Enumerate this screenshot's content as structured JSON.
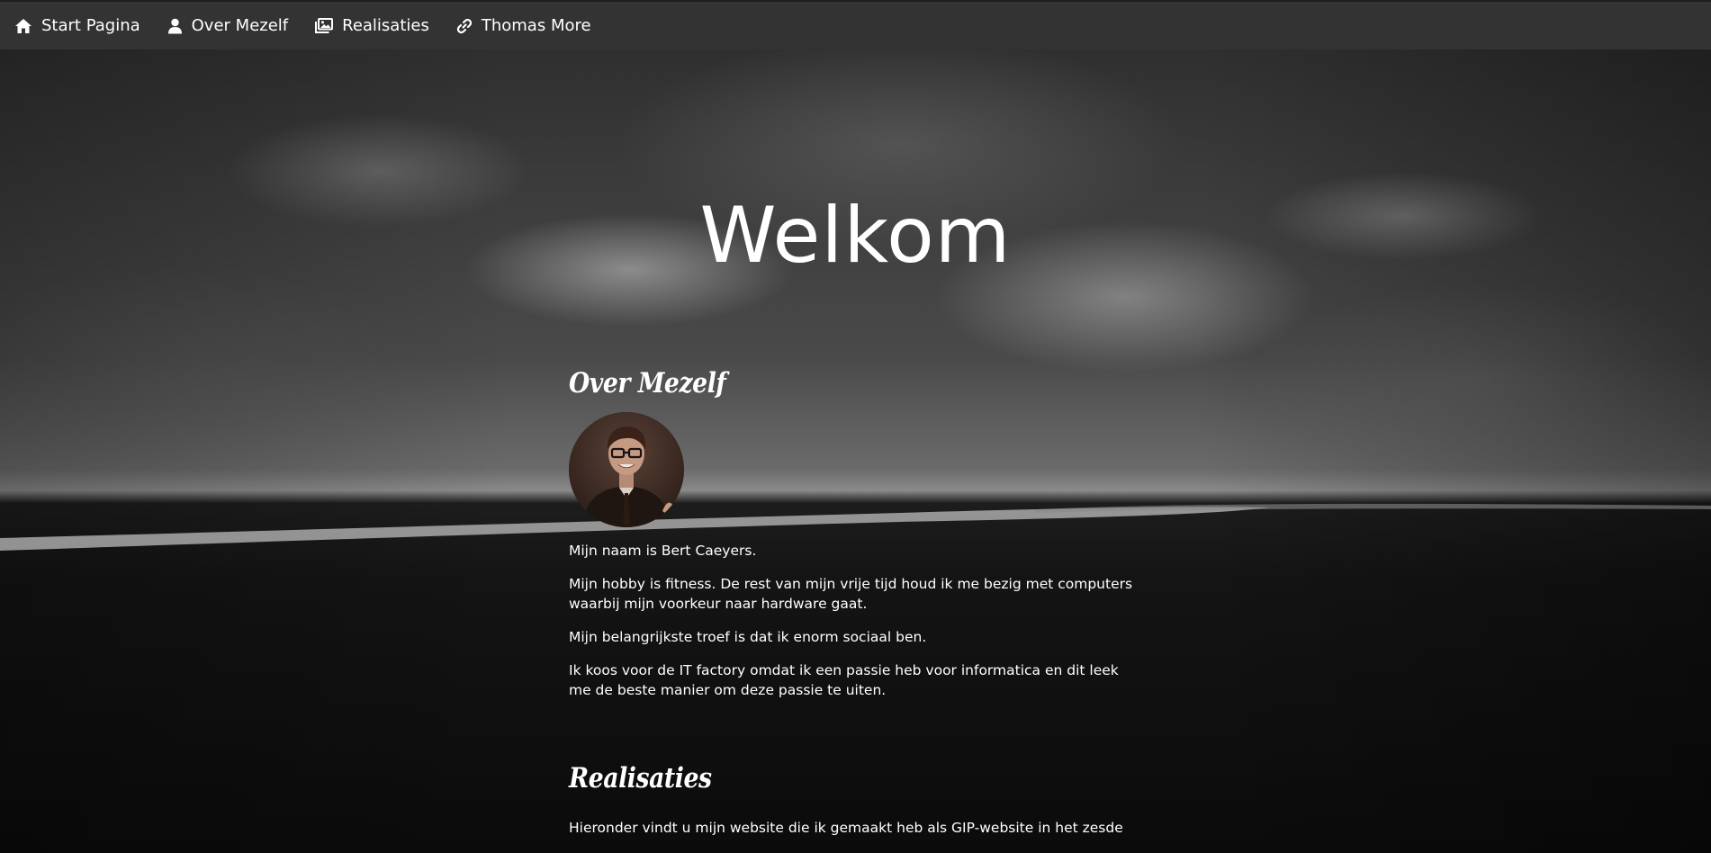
{
  "navbar": {
    "items": [
      {
        "label": "Start Pagina",
        "icon": "home-icon"
      },
      {
        "label": "Over Mezelf",
        "icon": "user-icon"
      },
      {
        "label": "Realisaties",
        "icon": "images-icon"
      },
      {
        "label": "Thomas More",
        "icon": "link-icon"
      }
    ]
  },
  "hero": {
    "title": "Welkom"
  },
  "about": {
    "title": "Over Mezelf",
    "paragraphs": [
      "Mijn naam is Bert Caeyers.",
      "Mijn hobby is fitness. De rest van mijn vrije tijd houd ik me bezig met computers waarbij mijn voorkeur naar hardware gaat.",
      "Mijn belangrijkste troef is dat ik enorm sociaal ben.",
      "Ik koos voor de IT factory omdat ik een passie heb voor informatica en dit leek me de beste manier om deze passie te uiten."
    ]
  },
  "realisaties": {
    "title": "Realisaties",
    "intro": "Hieronder vindt u mijn website die ik gemaakt heb als GIP-website in het zesde"
  },
  "colors": {
    "navbar_bg": "#333333",
    "text": "#ffffff"
  }
}
